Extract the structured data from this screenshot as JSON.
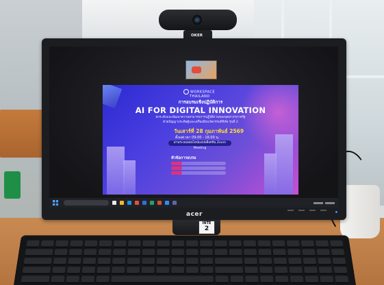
{
  "monitor": {
    "brand": "acer"
  },
  "webcam": {
    "label": "OKER"
  },
  "sticker": {
    "line1": "INTE",
    "number": "2"
  },
  "poster": {
    "logo_line1": "WORKSPACE",
    "logo_line2": "THAILAND",
    "pretitle": "การอบรมเชิงปฏิบัติการ",
    "title": "AI FOR DIGITAL INNOVATION",
    "subtitle_line1": "ยกระดับและพัฒนาความสามารถการปฏิบัติงานของบุคลากรภาครัฐ",
    "subtitle_line2": "ด้วยปัญญาประดิษฐ์และเครื่องมือนวัตกรรมดิจิทัล รุ่นที่ 2",
    "date": "วันเสาร์ที่ 28 กุมภาพันธ์ 2569",
    "time": "ตั้งแต่เวลา 09.00 - 16.00 น.",
    "zoom": "ผ่านระบบออนไลน์แอปพลิเคชัน Zoom Meeting",
    "topics_heading": "หัวข้อการอบรม"
  },
  "colors": {
    "poster_blue": "#2c2ad1",
    "poster_magenta": "#c64fd3",
    "date_yellow": "#ffdd33",
    "desk": "#b4743f"
  }
}
